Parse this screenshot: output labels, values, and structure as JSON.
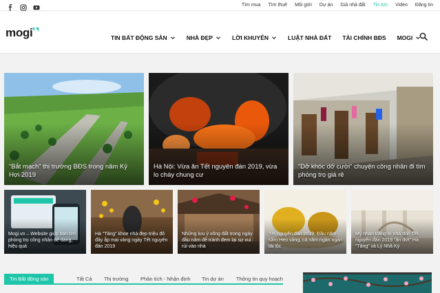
{
  "topbar": {
    "social_icons": [
      "facebook-icon",
      "instagram-icon",
      "youtube-icon"
    ],
    "links": [
      "Tìm mua",
      "Tìm thuê",
      "Môi giới",
      "Dự án",
      "Giá nhà đất",
      "Tin tức",
      "Video",
      "Đăng tin"
    ],
    "active_link": "Tin tức",
    "accent_color": "#1ec5a8"
  },
  "header": {
    "logo": "mogi",
    "nav": [
      {
        "label": "TIN BẤT ĐỘNG SẢN",
        "has_dropdown": true
      },
      {
        "label": "NHÀ ĐẸP",
        "has_dropdown": true
      },
      {
        "label": "LỜI KHUYÊN",
        "has_dropdown": true
      },
      {
        "label": "LUẬT NHÀ ĐẤT",
        "has_dropdown": false
      },
      {
        "label": "TÀI CHÍNH BĐS",
        "has_dropdown": false
      },
      {
        "label": "MOGI",
        "has_dropdown": true
      }
    ]
  },
  "hero": [
    {
      "title": "“Bắt mạch” thị trường BĐS trong năm Kỷ Hợi 2019"
    },
    {
      "title": "Hà Nội: Vừa ăn Tết nguyên đán 2019, vừa lo cháy chung cư"
    },
    {
      "title": "“Dở khóc dở cười” chuyện công nhân đi tìm phòng trọ giá rẻ"
    }
  ],
  "small_tiles": [
    {
      "title": "Mogi.vn – Website giúp bạn tìm phòng trọ công nhân dễ dàng, hiệu quả"
    },
    {
      "title": "Hà “Tăng” khoe nhà đẹp triệu đô đầy ắp mai vàng ngày Tết nguyên đán 2019"
    },
    {
      "title": "Những lưu ý xông đất trong ngày đầu năm để tránh đem lại sự xui rủi vào nhà"
    },
    {
      "title": "Tết nguyên đán 2019: Đầu năm sắm Heo vàng, cả năm ngàn ngàn tài lộc"
    },
    {
      "title": "Mỹ nhân trăng trị nhà đón Tết nguyên đán 2019 “ăn đứt” Hà “Tăng” và Lý Nhã Kỳ"
    }
  ],
  "section_tabs": {
    "main": "Tin Bất động sản",
    "items": [
      "Tất Cả",
      "Thị trường",
      "Phân tích - Nhận định",
      "Tin dự án",
      "Thông tin quy hoạch"
    ]
  }
}
